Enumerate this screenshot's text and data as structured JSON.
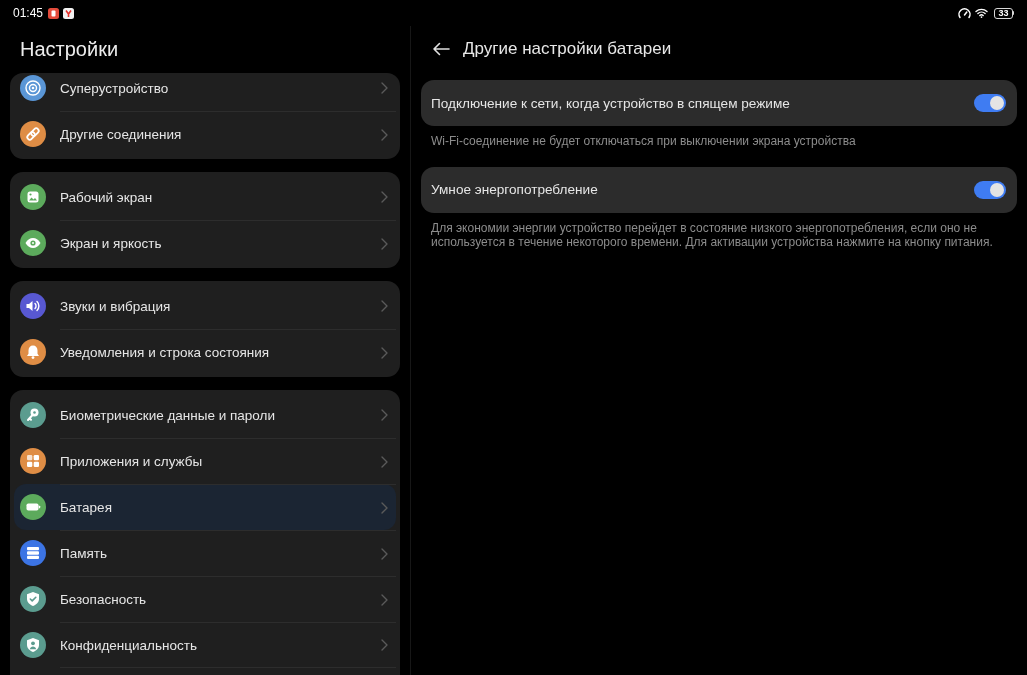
{
  "status_bar": {
    "time": "01:45",
    "battery": "33"
  },
  "sidebar": {
    "title": "Настройки",
    "groups": [
      {
        "items": [
          {
            "label": "Суперустройство",
            "selected": false
          },
          {
            "label": "Другие соединения",
            "selected": false
          }
        ]
      },
      {
        "items": [
          {
            "label": "Рабочий экран",
            "selected": false
          },
          {
            "label": "Экран и яркость",
            "selected": false
          }
        ]
      },
      {
        "items": [
          {
            "label": "Звуки и вибрация",
            "selected": false
          },
          {
            "label": "Уведомления и строка состояния",
            "selected": false
          }
        ]
      },
      {
        "items": [
          {
            "label": "Биометрические данные и пароли",
            "selected": false
          },
          {
            "label": "Приложения и службы",
            "selected": false
          },
          {
            "label": "Батарея",
            "selected": true
          },
          {
            "label": "Память",
            "selected": false
          },
          {
            "label": "Безопасность",
            "selected": false
          },
          {
            "label": "Конфиденциальность",
            "selected": false
          }
        ]
      }
    ]
  },
  "detail": {
    "title": "Другие настройки батареи",
    "settings": [
      {
        "label": "Подключение к сети, когда устройство в спящем режиме",
        "on": true,
        "description": "Wi-Fi-соединение не будет отключаться при выключении экрана устройства"
      },
      {
        "label": "Умное энергопотребление",
        "on": true,
        "description": "Для экономии энергии устройство перейдет в состояние низкого энергопотребления, если оно не используется в течение некоторого времени. Для активации устройства нажмите на кнопку питания."
      }
    ]
  }
}
